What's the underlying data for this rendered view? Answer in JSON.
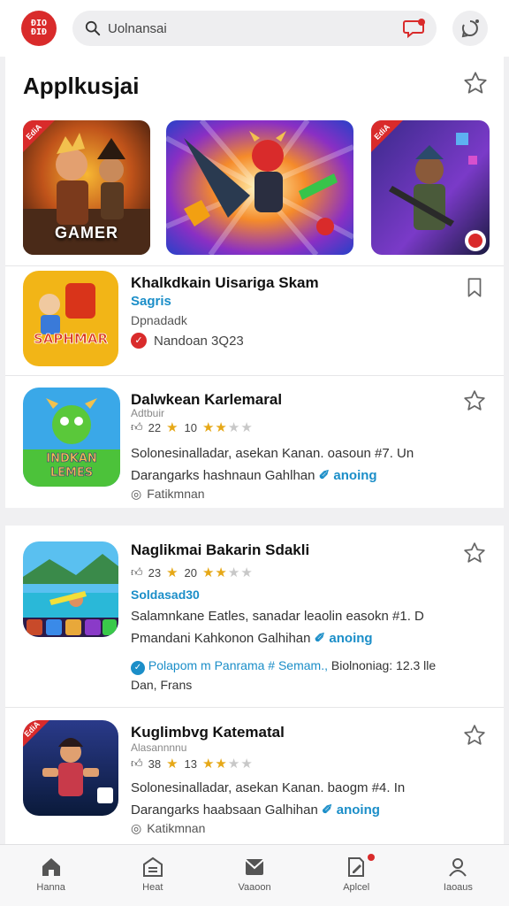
{
  "header": {
    "logo_text": "ĐIO\nĐIĐ",
    "search_value": "Uolnansai",
    "search_icon": "search-icon",
    "chat_icon": "chat-bubble-icon",
    "profile_icon": "chat-refresh-icon"
  },
  "section": {
    "title": "Applkusjai",
    "star_icon": "star-outline-icon"
  },
  "featured": [
    {
      "label": "GAMER",
      "ribbon": "EdiA"
    },
    {
      "label": ""
    },
    {
      "label": "",
      "ribbon": "EdiA"
    }
  ],
  "apps": [
    {
      "name": "Khalkdkain Uisariga Skam",
      "accent": "Sagris",
      "line2": "Dpnadadk",
      "verified_text": "Nandoan 3Q23",
      "icon_text": "SAPHMAR",
      "action_icon": "bookmark-icon"
    },
    {
      "name": "Dalwkean Karlemaral",
      "subtitle": "Adtbuir",
      "rating_count": "22",
      "rating_value": "10",
      "desc1": "Solonesinalladar, asekan Kanan. oasoun #7. Un",
      "desc2_prefix": "Darangarks hashnaun Gahlhan",
      "desc2_link": "anoing",
      "footer": "Fatikmnan",
      "icon_text": "INDKAN LEMES"
    },
    {
      "name": "Naglikmai Bakarin Sdakli",
      "rating_count": "23",
      "rating_value": "20",
      "accent": "Soldasad30",
      "desc1": "Salamnkane Eatles, sanadar leaolin easokn #1. D",
      "desc2_prefix": "Pmandani Kahkonon Galhihan",
      "desc2_link": "anoing",
      "promo_link": "Polapom m Panrama # Semam.,",
      "promo_rest": "Biolnoniag: 12.3 lle",
      "promo_line2": "Dan, Frans"
    },
    {
      "name": "Kuglimbvg Katematal",
      "subtitle": "Alasannnnu",
      "rating_count": "38",
      "rating_value": "13",
      "desc1": "Solonesinalladar, asekan Kanan. baogm #4. In",
      "desc2_prefix": "Darangarks haabsaan Galhihan",
      "desc2_link": "anoing",
      "footer": "Katikmnan",
      "ribbon": "EdiA"
    }
  ],
  "nav": [
    {
      "label": "Hanna",
      "icon": "home-icon"
    },
    {
      "label": "Heat",
      "icon": "store-icon"
    },
    {
      "label": "Vaaoon",
      "icon": "mail-icon"
    },
    {
      "label": "Aplcel",
      "icon": "edit-note-icon"
    },
    {
      "label": "Iaoaus",
      "icon": "person-icon"
    }
  ],
  "colors": {
    "brand_red": "#d92b2b",
    "accent_blue": "#1b8ec8",
    "star_gold": "#e6a817"
  }
}
